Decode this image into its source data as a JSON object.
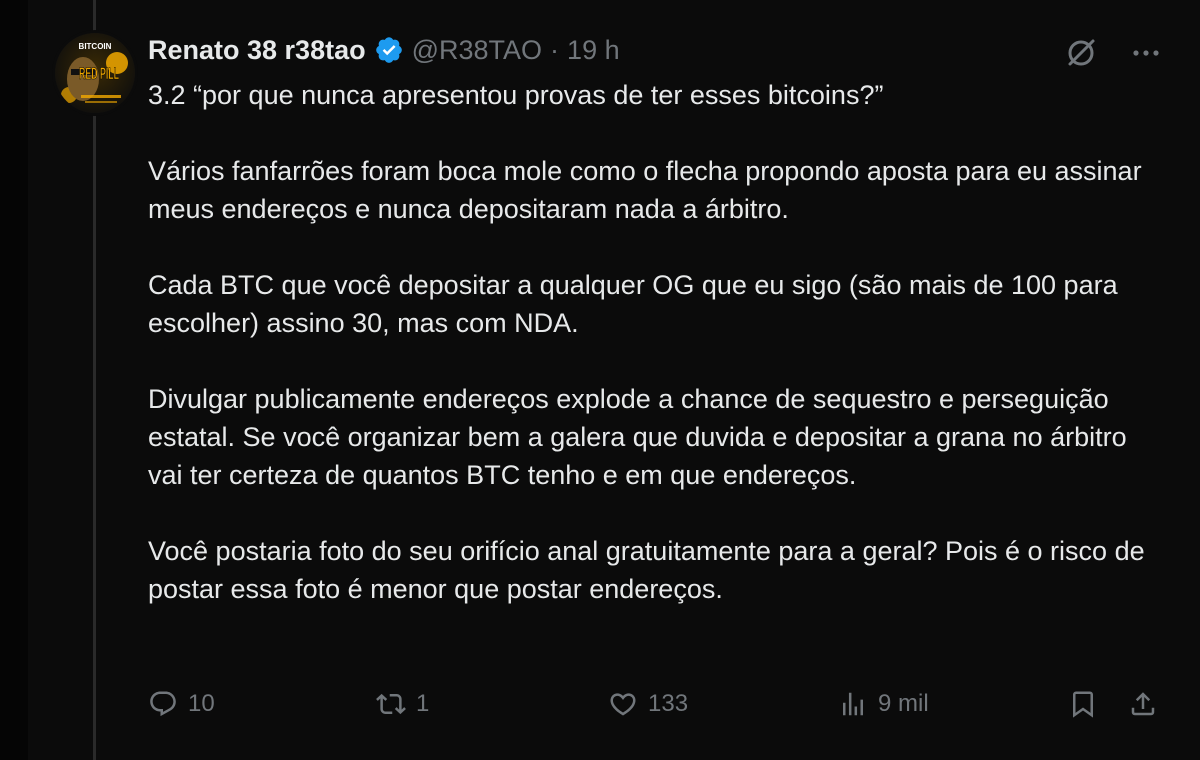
{
  "post": {
    "author": {
      "display_name": "Renato 38 r38tao",
      "handle": "@R38TAO",
      "verified": true,
      "avatar_text_top": "BITCOIN",
      "avatar_text_main": "RED PILL"
    },
    "separator": "·",
    "time": "19 h",
    "paragraphs": [
      "3.2 “por que nunca apresentou provas de ter esses bitcoins?”",
      "Vários fanfarrões foram boca mole como o flecha propondo aposta para eu assinar meus endereços e nunca depositaram nada a árbitro.",
      "Cada BTC que você depositar a qualquer OG que eu sigo (são mais de 100 para escolher) assino 30, mas com NDA.",
      "Divulgar publicamente endereços explode a chance de sequestro e perseguição estatal. Se você organizar bem a galera que duvida e depositar a grana no árbitro vai ter certeza de quantos BTC tenho e em que endereços.",
      "Você postaria foto do seu orifício anal gratuitamente para a geral? Pois é o risco de postar essa foto é menor que postar endereços."
    ],
    "actions": {
      "replies": "10",
      "reposts": "1",
      "likes": "133",
      "views": "9 mil"
    },
    "icons": {
      "grok": "grok-icon",
      "more": "more-icon",
      "reply": "reply-icon",
      "repost": "repost-icon",
      "like": "heart-icon",
      "views": "views-icon",
      "bookmark": "bookmark-icon",
      "share": "share-icon"
    },
    "colors": {
      "background": "#0b0b0b",
      "text": "#e7e9ea",
      "muted": "#71767b",
      "verified": "#1d9bf0",
      "avatar_accent": "#f2a900"
    }
  }
}
